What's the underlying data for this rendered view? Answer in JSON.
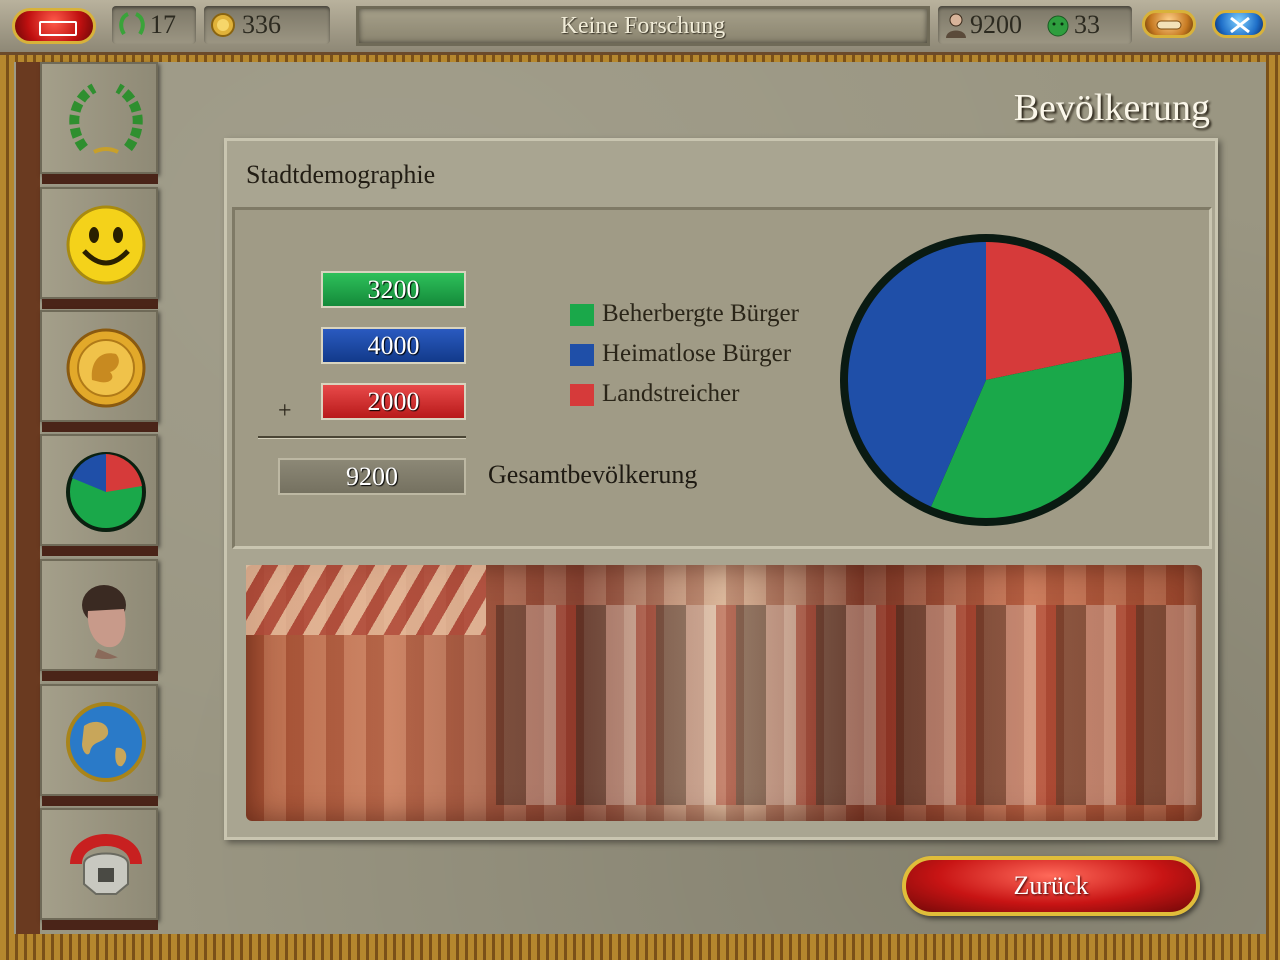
{
  "topbar": {
    "laurel_count": "17",
    "coins": "336",
    "research": "Keine Forschung",
    "population": "9200",
    "happiness": "33"
  },
  "sidebar": {
    "items": [
      {
        "icon": "laurel-wreath-icon"
      },
      {
        "icon": "smiley-icon"
      },
      {
        "icon": "gold-coin-icon"
      },
      {
        "icon": "pie-chart-icon"
      },
      {
        "icon": "emperor-bust-icon"
      },
      {
        "icon": "globe-icon"
      },
      {
        "icon": "centurion-helmet-icon"
      }
    ]
  },
  "page": {
    "title": "Bevölkerung",
    "section_title": "Stadtdemographie"
  },
  "demographics": {
    "values": [
      "3200",
      "4000",
      "2000"
    ],
    "plus": "+",
    "total": "9200",
    "total_label": "Gesamtbevölkerung",
    "legend": [
      {
        "label": "Beherbergte Bürger",
        "color": "#1aa84a"
      },
      {
        "label": "Heimatlose Bürger",
        "color": "#1f4fa8"
      },
      {
        "label": "Landstreicher",
        "color": "#d63a3a"
      }
    ]
  },
  "chart_data": {
    "type": "pie",
    "categories": [
      "Beherbergte Bürger",
      "Heimatlose Bürger",
      "Landstreicher"
    ],
    "values": [
      3200,
      4000,
      2000
    ],
    "colors": [
      "#1aa84a",
      "#1f4fa8",
      "#d63a3a"
    ]
  },
  "actions": {
    "back_label": "Zurück"
  }
}
